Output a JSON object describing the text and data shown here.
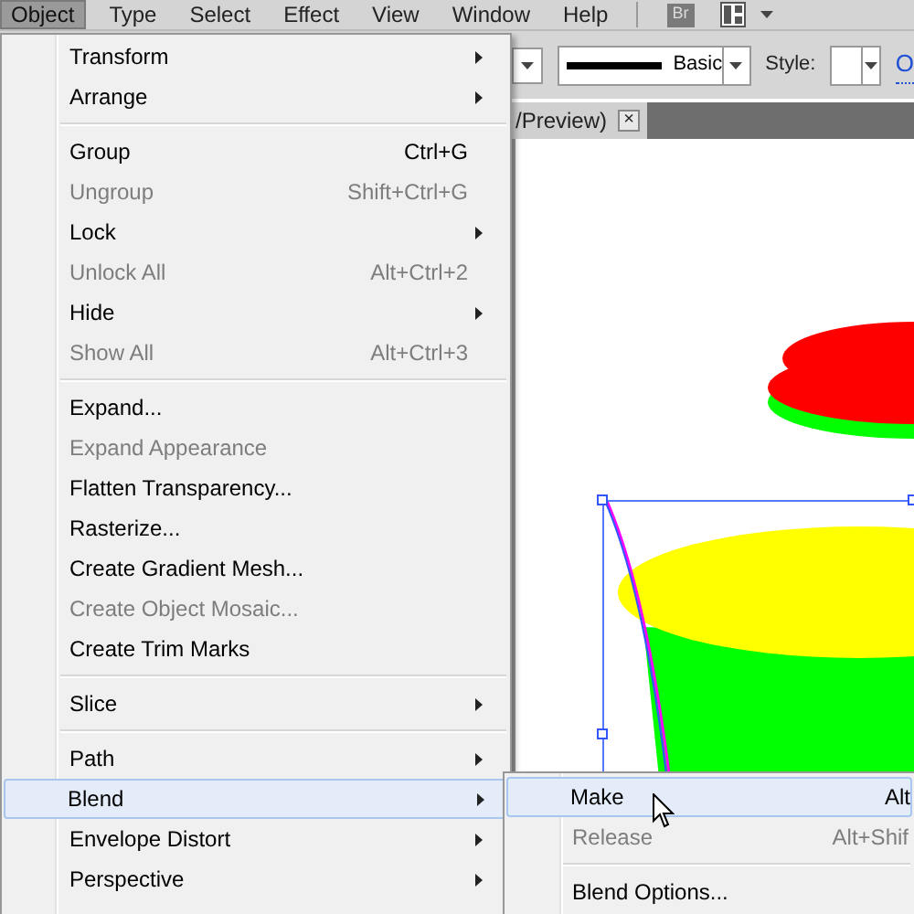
{
  "menubar": [
    {
      "label": "Object",
      "selected": true
    },
    {
      "label": "Type",
      "selected": false
    },
    {
      "label": "Select",
      "selected": false
    },
    {
      "label": "Effect",
      "selected": false
    },
    {
      "label": "View",
      "selected": false
    },
    {
      "label": "Window",
      "selected": false
    },
    {
      "label": "Help",
      "selected": false
    }
  ],
  "bridge_button": "Br",
  "control_bar": {
    "stroke_profile": "Basic",
    "style_label": "Style:",
    "link": "O"
  },
  "document_tab": {
    "title": "/Preview)",
    "close": "×"
  },
  "menu": [
    {
      "kind": "item",
      "label": "Transform",
      "submenu": true,
      "disabled": false,
      "selected": false
    },
    {
      "kind": "item",
      "label": "Arrange",
      "submenu": true,
      "disabled": false,
      "selected": false
    },
    {
      "kind": "separator"
    },
    {
      "kind": "item",
      "label": "Group",
      "shortcut": "Ctrl+G",
      "submenu": false,
      "disabled": false,
      "selected": false
    },
    {
      "kind": "item",
      "label": "Ungroup",
      "shortcut": "Shift+Ctrl+G",
      "submenu": false,
      "disabled": true,
      "selected": false
    },
    {
      "kind": "item",
      "label": "Lock",
      "submenu": true,
      "disabled": false,
      "selected": false
    },
    {
      "kind": "item",
      "label": "Unlock All",
      "shortcut": "Alt+Ctrl+2",
      "submenu": false,
      "disabled": true,
      "selected": false
    },
    {
      "kind": "item",
      "label": "Hide",
      "submenu": true,
      "disabled": false,
      "selected": false
    },
    {
      "kind": "item",
      "label": "Show All",
      "shortcut": "Alt+Ctrl+3",
      "submenu": false,
      "disabled": true,
      "selected": false
    },
    {
      "kind": "separator"
    },
    {
      "kind": "item",
      "label": "Expand...",
      "submenu": false,
      "disabled": false,
      "selected": false
    },
    {
      "kind": "item",
      "label": "Expand Appearance",
      "submenu": false,
      "disabled": true,
      "selected": false
    },
    {
      "kind": "item",
      "label": "Flatten Transparency...",
      "submenu": false,
      "disabled": false,
      "selected": false
    },
    {
      "kind": "item",
      "label": "Rasterize...",
      "submenu": false,
      "disabled": false,
      "selected": false
    },
    {
      "kind": "item",
      "label": "Create Gradient Mesh...",
      "submenu": false,
      "disabled": false,
      "selected": false
    },
    {
      "kind": "item",
      "label": "Create Object Mosaic...",
      "submenu": false,
      "disabled": true,
      "selected": false
    },
    {
      "kind": "item",
      "label": "Create Trim Marks",
      "submenu": false,
      "disabled": false,
      "selected": false
    },
    {
      "kind": "separator"
    },
    {
      "kind": "item",
      "label": "Slice",
      "submenu": true,
      "disabled": false,
      "selected": false
    },
    {
      "kind": "separator"
    },
    {
      "kind": "item",
      "label": "Path",
      "submenu": true,
      "disabled": false,
      "selected": false
    },
    {
      "kind": "item",
      "label": "Blend",
      "submenu": true,
      "disabled": false,
      "selected": true
    },
    {
      "kind": "item",
      "label": "Envelope Distort",
      "submenu": true,
      "disabled": false,
      "selected": false
    },
    {
      "kind": "item",
      "label": "Perspective",
      "submenu": true,
      "disabled": false,
      "selected": false
    }
  ],
  "blend_submenu": [
    {
      "kind": "item",
      "label": "Make",
      "shortcut": "Alt",
      "disabled": false,
      "selected": true
    },
    {
      "kind": "item",
      "label": "Release",
      "shortcut": "Alt+Shif",
      "disabled": true,
      "selected": false
    },
    {
      "kind": "separator"
    },
    {
      "kind": "item",
      "label": "Blend Options...",
      "disabled": false,
      "selected": false
    }
  ]
}
